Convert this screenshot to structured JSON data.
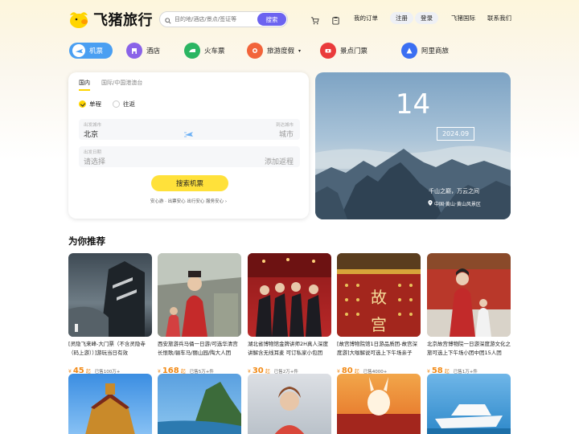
{
  "header": {
    "logo_text": "飞猪旅行",
    "search_placeholder": "目的地/酒店/景点/签证等",
    "search_button": "搜索",
    "my_orders": "我的订单",
    "register": "注册",
    "login": "登录",
    "intl": "飞猪国际",
    "contact": "联系我们"
  },
  "categories": [
    {
      "label": "机票",
      "icon": "plane-icon",
      "active": true
    },
    {
      "label": "酒店",
      "icon": "hotel-icon"
    },
    {
      "label": "火车票",
      "icon": "train-icon"
    },
    {
      "label": "旅游度假",
      "icon": "vacation-icon",
      "dropdown": true
    },
    {
      "label": "景点门票",
      "icon": "ticket-icon"
    },
    {
      "label": "阿里商旅",
      "icon": "business-icon"
    }
  ],
  "booking": {
    "tabs": [
      "国内",
      "国际/中国港澳台"
    ],
    "trip_types": [
      "单程",
      "往返"
    ],
    "from_label": "出发城市",
    "from_value": "北京",
    "to_label": "到达城市",
    "to_placeholder": "城市",
    "date_label": "出发日期",
    "date_placeholder": "请选择",
    "return_placeholder": "添加返程",
    "search_button": "搜索机票",
    "assurance": "安心游 · 出票安心 出行安心 服务安心 ›"
  },
  "banner": {
    "day": "14",
    "month": "2024.09",
    "caption": "千山之巅，万云之间",
    "location": "中国·黄山·黄山风景区"
  },
  "recommend": {
    "title": "为你推荐",
    "items": [
      {
        "name": "[灵隐飞来峰-大门票（不含灵隐寺（码上游））]游玩当日有效",
        "price": "45",
        "sold": "已售100万+"
      },
      {
        "name": "西安旅游兵马俑一日游/可选华清宫长恨歌/骊车马/丽山园/陶大人团",
        "price": "168",
        "sold": "已售5万+件"
      },
      {
        "name": "湖北省博物馆金牌讲师2H真人深度讲解含无线耳麦 可订私家小包团",
        "price": "30",
        "sold": "已售2万+件"
      },
      {
        "name": "[故宫博物院馆1日游品质团-故宫深度游]大咖解说可选上下午场亲子",
        "price": "80",
        "sold": "已售4000+"
      },
      {
        "name": "北京故宫博物院一日游深度游文化之旅可选上下午场小团中团15人团",
        "price": "58",
        "sold": "已售1万+件"
      }
    ],
    "price_prefix": "¥",
    "price_suffix": "起"
  },
  "colors": {
    "accent_yellow": "#ffe13a",
    "search_purple": "#6c63f0",
    "price_orange": "#f28a16",
    "active_blue": "#4a9ff2"
  }
}
